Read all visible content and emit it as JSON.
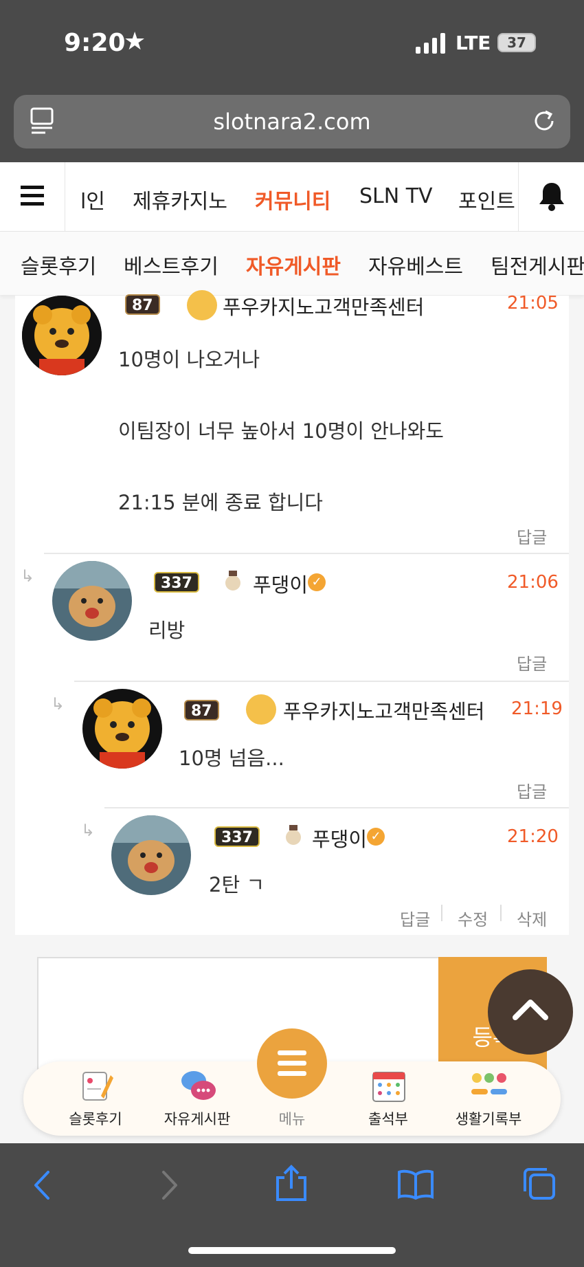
{
  "status_bar": {
    "time": "9:20",
    "network": "LTE",
    "battery": "37"
  },
  "browser": {
    "url": "slotnara2.com"
  },
  "main_nav": {
    "items": [
      "l인",
      "제휴카지노",
      "커뮤니티",
      "SLN TV",
      "포인트"
    ],
    "active": "커뮤니티"
  },
  "sub_nav": {
    "items": [
      "슬롯후기",
      "베스트후기",
      "자유게시판",
      "자유베스트",
      "팀전게시판"
    ],
    "active": "자유게시판"
  },
  "comments": [
    {
      "user": "푸우카지노고객만족센터",
      "level": "87",
      "time": "21:05",
      "lines": [
        "10명이 나오거나",
        "이팀장이 너무 높아서 10명이 안나와도",
        "21:15 분에 종료 합니다"
      ],
      "actions": [
        "답글"
      ]
    },
    {
      "user": "푸댕이",
      "level": "337",
      "time": "21:06",
      "lines": [
        "리방"
      ],
      "actions": [
        "답글"
      ]
    },
    {
      "user": "푸우카지노고객만족센터",
      "level": "87",
      "time": "21:19",
      "lines": [
        "10명 넘음..."
      ],
      "actions": [
        "답글"
      ]
    },
    {
      "user": "푸댕이",
      "level": "337",
      "time": "21:20",
      "lines": [
        "2탄 ㄱ"
      ],
      "actions": [
        "답글",
        "수정",
        "삭제"
      ]
    }
  ],
  "comment_form": {
    "submit_label": "등록"
  },
  "floating_menu": {
    "items": [
      "슬롯후기",
      "자유게시판",
      "메뉴",
      "출석부",
      "생활기록부"
    ]
  },
  "colors": {
    "accent": "#f05a28",
    "button": "#eba33e",
    "dark": "#4a4a4a"
  }
}
